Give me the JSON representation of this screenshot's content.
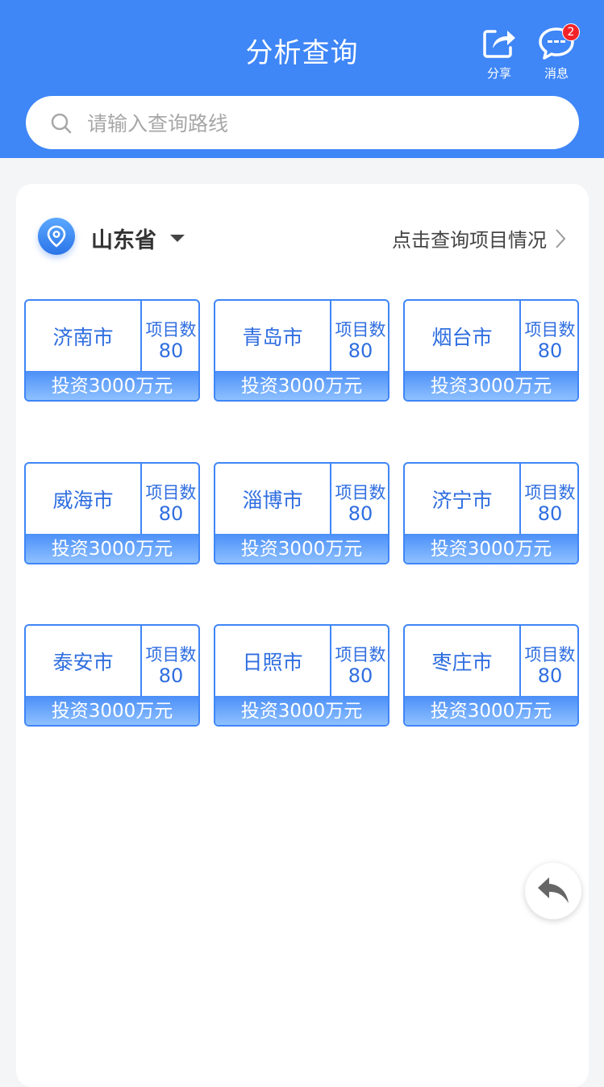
{
  "header": {
    "title": "分析查询",
    "share_label": "分享",
    "message_label": "消息",
    "message_badge": "2"
  },
  "search": {
    "placeholder": "请输入查询路线"
  },
  "region": {
    "province": "山东省",
    "query_link": "点击查询项目情况"
  },
  "cities": [
    {
      "name": "济南市",
      "count_label": "项目数",
      "count": "80",
      "investment": "投资3000万元"
    },
    {
      "name": "青岛市",
      "count_label": "项目数",
      "count": "80",
      "investment": "投资3000万元"
    },
    {
      "name": "烟台市",
      "count_label": "项目数",
      "count": "80",
      "investment": "投资3000万元"
    },
    {
      "name": "威海市",
      "count_label": "项目数",
      "count": "80",
      "investment": "投资3000万元"
    },
    {
      "name": "淄博市",
      "count_label": "项目数",
      "count": "80",
      "investment": "投资3000万元"
    },
    {
      "name": "济宁市",
      "count_label": "项目数",
      "count": "80",
      "investment": "投资3000万元"
    },
    {
      "name": "泰安市",
      "count_label": "项目数",
      "count": "80",
      "investment": "投资3000万元"
    },
    {
      "name": "日照市",
      "count_label": "项目数",
      "count": "80",
      "investment": "投资3000万元"
    },
    {
      "name": "枣庄市",
      "count_label": "项目数",
      "count": "80",
      "investment": "投资3000万元"
    }
  ],
  "colors": {
    "primary": "#3f86f7",
    "badge": "#f2242a",
    "background": "#f4f5f7"
  },
  "icons": {
    "share": "share-icon",
    "message": "chat-bubble-icon",
    "search": "search-icon",
    "location": "location-pin-icon",
    "dropdown": "caret-down-icon",
    "link": "chevron-right-icon",
    "back": "reply-arrow-icon"
  }
}
